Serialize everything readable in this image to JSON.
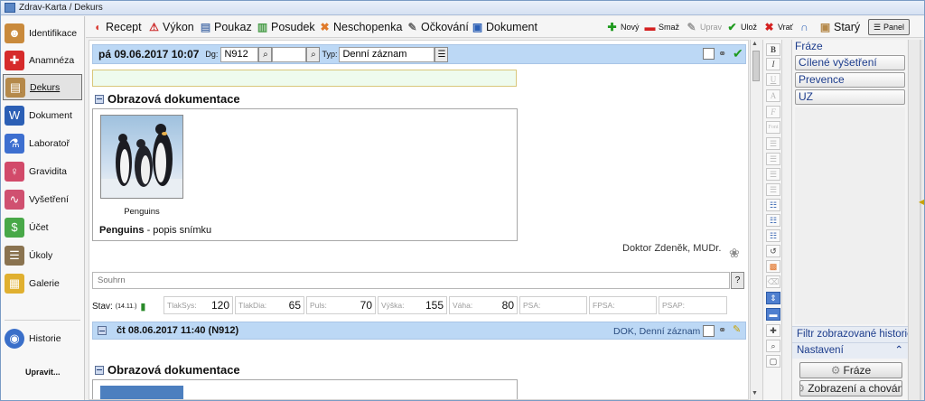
{
  "window": {
    "title": "Zdrav-Karta / Dekurs"
  },
  "nav": {
    "items": [
      {
        "label": "Identifikace",
        "icon": "person-icon",
        "color": "#c98a3c"
      },
      {
        "label": "Anamnéza",
        "icon": "red-cross-icon",
        "color": "#d62b2b"
      },
      {
        "label": "Dekurs",
        "icon": "folder-icon",
        "color": "#b5894a"
      },
      {
        "label": "Dokument",
        "icon": "word-document-icon",
        "color": "#2b5fb5"
      },
      {
        "label": "Laboratoř",
        "icon": "flask-icon",
        "color": "#3d6fd0"
      },
      {
        "label": "Gravidita",
        "icon": "woman-icon",
        "color": "#d24a6a"
      },
      {
        "label": "Vyšetření",
        "icon": "ecg-icon",
        "color": "#d05070"
      },
      {
        "label": "Účet",
        "icon": "money-icon",
        "color": "#48a848"
      },
      {
        "label": "Úkoly",
        "icon": "clipboard-icon",
        "color": "#8a7350"
      },
      {
        "label": "Galerie",
        "icon": "gallery-folder-icon",
        "color": "#e0b030"
      }
    ],
    "history": {
      "label": "Historie",
      "icon": "globe-icon",
      "color": "#3a6fc9"
    },
    "edit_label": "Upravit..."
  },
  "toolbar": {
    "items": [
      {
        "label": "Recept",
        "icon": "pill-icon",
        "color": "#d8342b"
      },
      {
        "label": "Výkon",
        "icon": "warning-triangle-icon",
        "color": "#cc2a2a"
      },
      {
        "label": "Poukaz",
        "icon": "document-icon",
        "color": "#5a7bb0"
      },
      {
        "label": "Posudek",
        "icon": "certificate-icon",
        "color": "#4a9d4a"
      },
      {
        "label": "Neschopenka",
        "icon": "cross-bandage-icon",
        "color": "#e07a2a"
      },
      {
        "label": "Očkování",
        "icon": "syringe-icon",
        "color": "#666666"
      },
      {
        "label": "Dokument",
        "icon": "word-document-icon",
        "color": "#2b5fb5"
      }
    ],
    "actions": [
      {
        "label": "Nový",
        "icon": "plus-icon",
        "color": "#1f9a1f",
        "enabled": true
      },
      {
        "label": "Smaž",
        "icon": "minus-icon",
        "color": "#d42020",
        "enabled": true
      },
      {
        "label": "Uprav",
        "icon": "pencil-icon",
        "color": "#999999",
        "enabled": false
      },
      {
        "label": "Ulož",
        "icon": "checkmark-icon",
        "color": "#1f9a1f",
        "enabled": true
      },
      {
        "label": "Vrať",
        "icon": "x-icon",
        "color": "#d42020",
        "enabled": true
      },
      {
        "label": "",
        "icon": "headset-icon",
        "color": "#2b5fb5",
        "enabled": true
      },
      {
        "label": "Starý",
        "icon": "archive-icon",
        "color": "#b5894a",
        "enabled": true
      }
    ],
    "panel_label": "Panel"
  },
  "record1": {
    "date": "pá 09.06.2017 10:07",
    "dg_label": "Dg:",
    "dg_value": "N912",
    "typ_label": "Typ:",
    "typ_value": "Denní záznam",
    "section_title": "Obrazová dokumentace",
    "image_caption": "Penguins",
    "image_title": "Penguins",
    "image_desc": " - popis snímku",
    "doctor": "Doktor Zdeněk, MUDr.",
    "souhrn_placeholder": "Souhrn",
    "question_label": "?",
    "stav_label": "Stav:",
    "stav_date": "(14.11.)",
    "vitals": [
      {
        "label": "TlakSys:",
        "value": "120"
      },
      {
        "label": "TlakDia:",
        "value": "65"
      },
      {
        "label": "Puls:",
        "value": "70"
      },
      {
        "label": "Výška:",
        "value": "155"
      },
      {
        "label": "Váha:",
        "value": "80"
      },
      {
        "label": "PSA:",
        "value": ""
      },
      {
        "label": "FPSA:",
        "value": ""
      },
      {
        "label": "PSAP:",
        "value": ""
      }
    ]
  },
  "record2": {
    "date": "čt 08.06.2017 11:40 (N912)",
    "type_info": "DOK, Denní záznam",
    "section_title": "Obrazová dokumentace"
  },
  "format_buttons": [
    {
      "label": "B",
      "name": "bold-button"
    },
    {
      "label": "I",
      "name": "italic-button"
    },
    {
      "label": "U",
      "name": "underline-button"
    },
    {
      "label": "A",
      "name": "font-color-button"
    },
    {
      "label": "F",
      "name": "font-button"
    },
    {
      "label": "Font",
      "name": "font-size-button"
    }
  ],
  "right_panel": {
    "title": "Fráze",
    "items": [
      "Cílené vyšetření",
      "Prevence",
      "UZ"
    ],
    "filter_label": "Filtr zobrazované historie",
    "settings_label": "Nastavení",
    "phrases_button": "Fráze",
    "display_button": "Zobrazení a chování"
  }
}
